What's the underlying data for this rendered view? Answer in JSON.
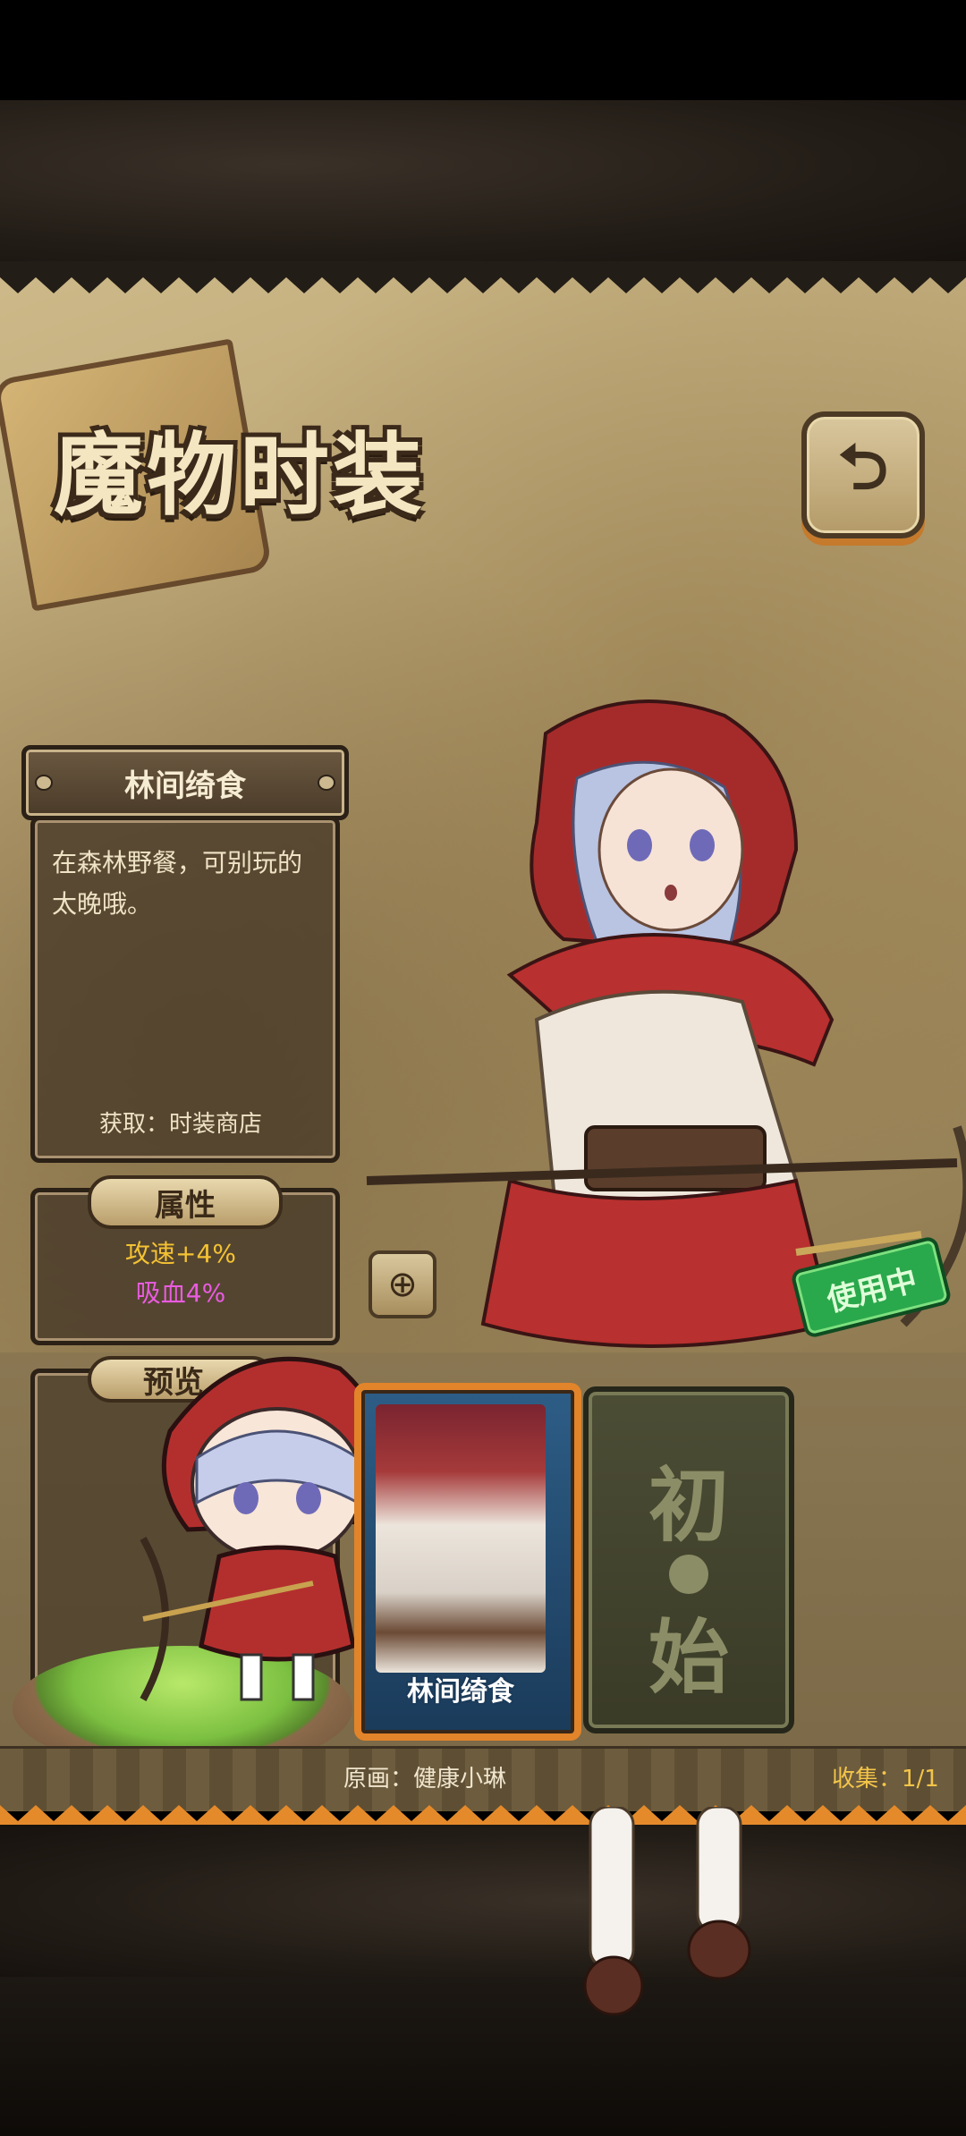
{
  "screen": {
    "title": "魔物时装",
    "back_icon": "return-arrow-icon"
  },
  "costume": {
    "name": "林间绮食",
    "description": "在森林野餐，可别玩的太晚哦。",
    "acquire": "获取：时装商店",
    "status_badge": "使用中"
  },
  "attributes": {
    "header": "属性",
    "atk_speed": "攻速+4%",
    "lifesteal": "吸血4%"
  },
  "preview": {
    "header": "预览"
  },
  "cards": [
    {
      "label": "林间绮食",
      "selected": true
    },
    {
      "label_top": "初",
      "label_bottom": "始",
      "selected": false
    }
  ],
  "credits": {
    "artist": "原画：健康小琳",
    "collection": "收集：1/1"
  },
  "colors": {
    "atk_speed": "#f4c233",
    "lifesteal": "#e95be0",
    "badge": "#2aa84c",
    "card_border": "#e2842a"
  }
}
